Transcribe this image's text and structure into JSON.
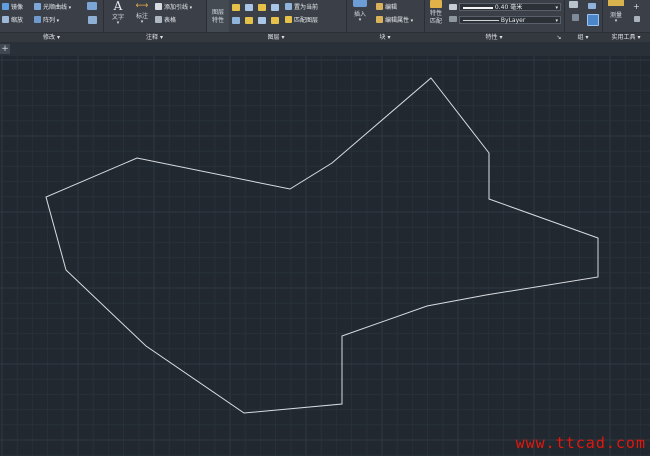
{
  "ribbon": {
    "panels": {
      "modify": "修改",
      "annotation": "注释",
      "layers": "图层",
      "block": "块",
      "properties": "特性",
      "groups": "组",
      "utilities": "实用工具"
    },
    "modify": {
      "mirror": "镜像",
      "fillet": "光顺曲线",
      "scale": "缩放",
      "array": "阵列"
    },
    "annotation": {
      "text": "文字",
      "dimension": "标注",
      "multileader": "添加引线",
      "table": "表格"
    },
    "layers": {
      "layer_props_line1": "图层",
      "layer_props_line2": "特性",
      "set_current": "置为当前",
      "match_layer": "匹配图层"
    },
    "block": {
      "insert": "插入",
      "edit": "编辑",
      "edit_attributes": "编辑属性"
    },
    "properties": {
      "match_line1": "特性",
      "match_line2": "匹配",
      "lineweight": "0.40 毫米",
      "linetype": "ByLayer"
    },
    "utilities": {
      "measure": "测量"
    }
  },
  "canvas": {
    "background": "#212830",
    "grid_minor": "#283039",
    "grid_major": "#2f3944",
    "stroke": "#d9dde2"
  },
  "watermark": "www.ttcad.com"
}
